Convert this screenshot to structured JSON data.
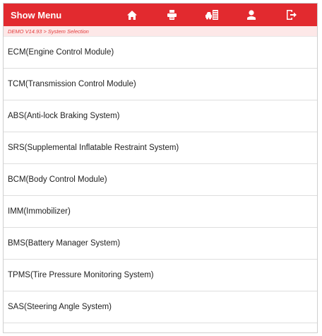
{
  "header": {
    "title": "Show Menu",
    "icons": [
      "home-icon",
      "print-icon",
      "vehicle-info-icon",
      "user-icon",
      "exit-icon"
    ],
    "accent": "#e22a2f"
  },
  "breadcrumb": "DEMO V14.93 > System Selection",
  "systems": [
    "ECM(Engine Control Module)",
    "TCM(Transmission Control Module)",
    "ABS(Anti-lock Braking System)",
    "SRS(Supplemental Inflatable Restraint System)",
    "BCM(Body Control Module)",
    "IMM(Immobilizer)",
    "BMS(Battery Manager System)",
    "TPMS(Tire Pressure Monitoring System)",
    "SAS(Steering Angle System)"
  ]
}
